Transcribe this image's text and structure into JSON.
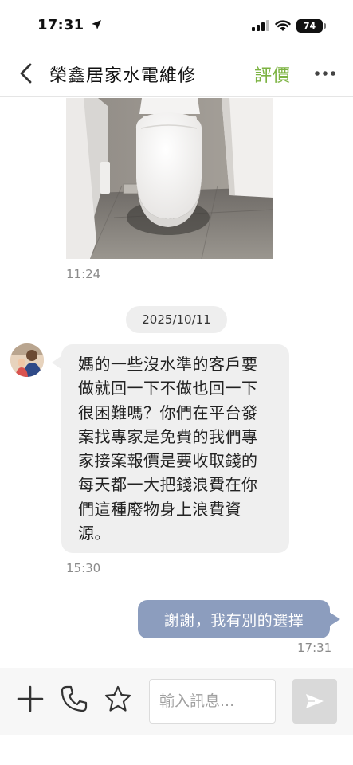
{
  "status_bar": {
    "time": "17:31",
    "battery": "74"
  },
  "header": {
    "title": "榮鑫居家水電維修",
    "rate_label": "評價"
  },
  "messages": {
    "photo_time": "11:24",
    "date_divider": "2025/10/11",
    "incoming": {
      "lines": [
        "媽的一些沒水準的客戶要",
        "做就回一下不做也回一下",
        "很困難嗎？你們在平台發",
        "案找專家是免費的我們專",
        "家接案報價是要收取錢的",
        "每天都一大把錢浪費在你",
        "們這種廢物身上浪費資",
        "源。"
      ],
      "time": "15:30"
    },
    "outgoing": {
      "text": "謝謝，我有別的選擇",
      "time": "17:31"
    }
  },
  "input_bar": {
    "placeholder": "輸入訊息..."
  },
  "icons": {
    "back": "chevron-left-icon",
    "more": "more-horizontal-icon",
    "add": "plus-icon",
    "call": "phone-icon",
    "favorite": "star-icon",
    "send": "send-icon",
    "location": "location-arrow-icon",
    "signal": "cellular-signal-icon",
    "wifi": "wifi-icon",
    "battery": "battery-icon"
  },
  "colors": {
    "accent_green": "#7cb342",
    "outgoing_bubble": "#8c9dbe",
    "incoming_bubble": "#efefef"
  }
}
